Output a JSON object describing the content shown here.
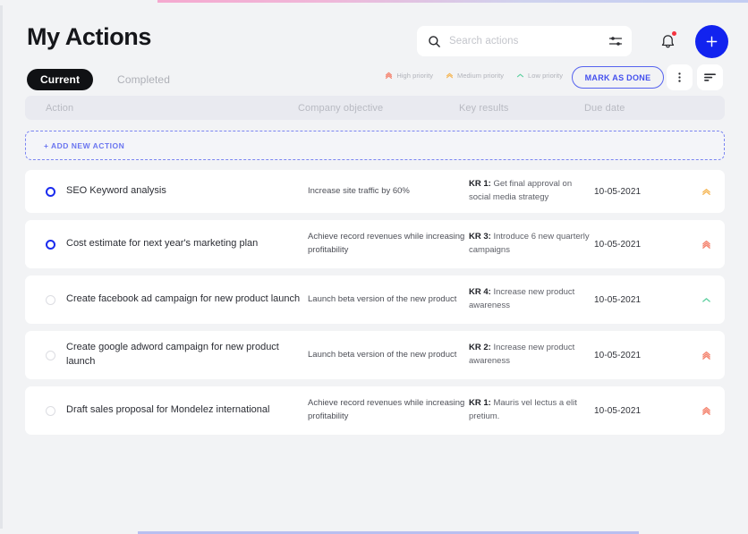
{
  "header": {
    "title": "My Actions",
    "search": {
      "placeholder": "Search actions",
      "value": "",
      "search_icon": "search-icon",
      "tune_icon": "tune-icon"
    },
    "bell_icon": "bell-icon",
    "add_icon": "plus-icon"
  },
  "tabs": [
    {
      "label": "Current",
      "active": true
    },
    {
      "label": "Completed",
      "active": false
    }
  ],
  "legend": [
    {
      "label": "High priority",
      "level": "high",
      "color": "#f4836e"
    },
    {
      "label": "Medium priority",
      "level": "medium",
      "color": "#f5b552"
    },
    {
      "label": "Low priority",
      "level": "low",
      "color": "#5fd0a0"
    }
  ],
  "toolbar": {
    "mark_as_done_label": "MARK AS DONE",
    "kebab_icon": "more-vertical-icon",
    "sort_icon": "sort-descending-icon"
  },
  "table": {
    "columns": [
      "Action",
      "Company objective",
      "Key results",
      "Due date"
    ],
    "add_new_label": "+ ADD NEW ACTION",
    "rows": [
      {
        "selected": true,
        "action": "SEO Keyword analysis",
        "objective": "Increase site traffic by 60%",
        "kr_tag": "KR 1:",
        "kr_text": " Get final approval on social media strategy",
        "due_date": "10-05-2021",
        "priority": "medium"
      },
      {
        "selected": true,
        "action": "Cost estimate for next year's marketing plan",
        "objective": "Achieve record revenues while increasing profitability",
        "kr_tag": "KR 3:",
        "kr_text": " Introduce 6 new quarterly campaigns",
        "due_date": "10-05-2021",
        "priority": "high"
      },
      {
        "selected": false,
        "action": "Create facebook ad campaign for new product launch",
        "objective": "Launch beta version of the new product",
        "kr_tag": "KR 4:",
        "kr_text": " Increase new product awareness",
        "due_date": "10-05-2021",
        "priority": "low"
      },
      {
        "selected": false,
        "action": "Create google adword campaign for new product launch",
        "objective": "Launch beta version of the new product",
        "kr_tag": "KR 2:",
        "kr_text": " Increase new product awareness",
        "due_date": "10-05-2021",
        "priority": "high"
      },
      {
        "selected": false,
        "action": "Draft sales proposal for Mondelez international",
        "objective": "Achieve record revenues while increasing profitability",
        "kr_tag": "KR 1:",
        "kr_text": " Mauris vel lectus a elit pretium.",
        "due_date": "10-05-2021",
        "priority": "high"
      }
    ]
  },
  "colors": {
    "accent_blue": "#1223ef",
    "link_blue": "#4450ee",
    "high": "#f4836e",
    "medium": "#f5b552",
    "low": "#5fd0a0",
    "page_bg": "#f2f3f5"
  }
}
